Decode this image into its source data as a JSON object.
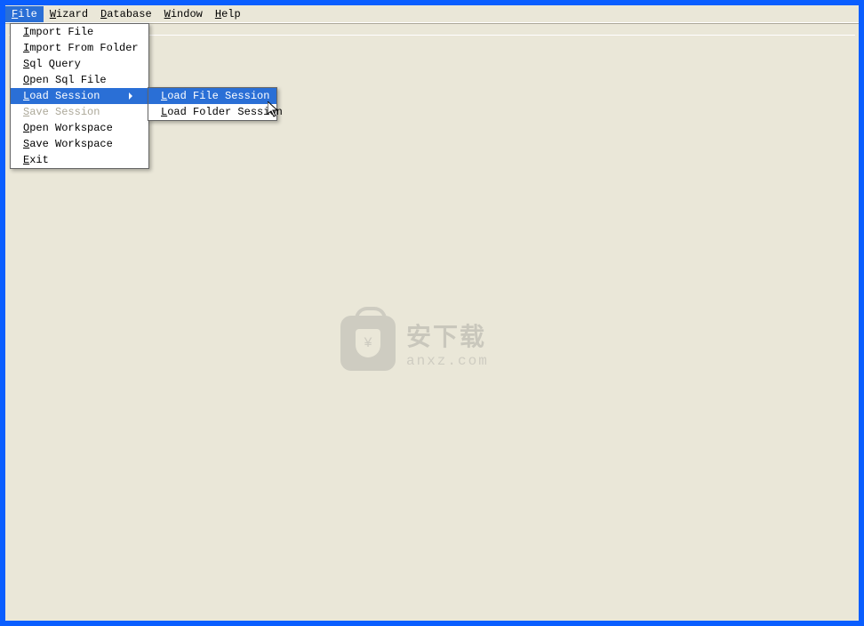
{
  "menubar": {
    "items": [
      {
        "label": "File",
        "active": true
      },
      {
        "label": "Wizard",
        "active": false
      },
      {
        "label": "Database",
        "active": false
      },
      {
        "label": "Window",
        "active": false
      },
      {
        "label": "Help",
        "active": false
      }
    ]
  },
  "file_menu": {
    "items": [
      {
        "label": "Import File",
        "disabled": false,
        "submenu": false,
        "highlighted": false
      },
      {
        "label": "Import From Folder",
        "disabled": false,
        "submenu": false,
        "highlighted": false
      },
      {
        "label": "Sql Query",
        "disabled": false,
        "submenu": false,
        "highlighted": false
      },
      {
        "label": "Open Sql File",
        "disabled": false,
        "submenu": false,
        "highlighted": false
      },
      {
        "label": "Load Session",
        "disabled": false,
        "submenu": true,
        "highlighted": true
      },
      {
        "label": "Save Session",
        "disabled": true,
        "submenu": false,
        "highlighted": false
      },
      {
        "label": "Open Workspace",
        "disabled": false,
        "submenu": false,
        "highlighted": false
      },
      {
        "label": "Save Workspace",
        "disabled": false,
        "submenu": false,
        "highlighted": false
      },
      {
        "label": "Exit",
        "disabled": false,
        "submenu": false,
        "highlighted": false
      }
    ]
  },
  "load_session_submenu": {
    "items": [
      {
        "label": "Load File Session",
        "highlighted": true
      },
      {
        "label": "Load Folder Session",
        "highlighted": false
      }
    ]
  },
  "watermark": {
    "cn": "安下载",
    "en": "anxz.com"
  }
}
